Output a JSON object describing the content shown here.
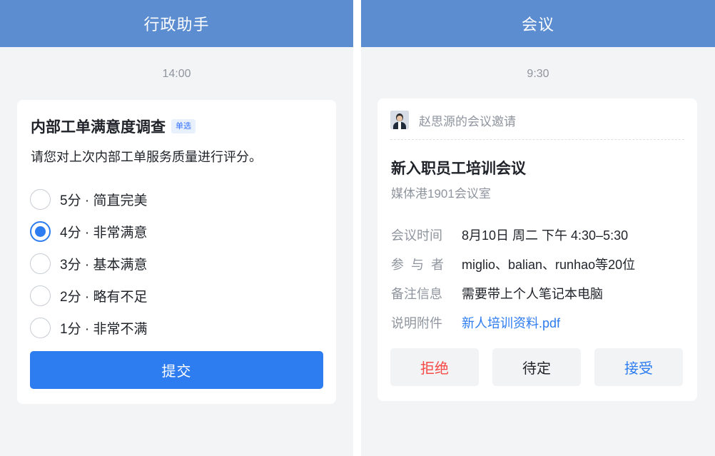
{
  "left_panel": {
    "title": "行政助手",
    "timestamp": "14:00",
    "survey": {
      "title": "内部工单满意度调查",
      "badge": "单选",
      "description": "请您对上次内部工单服务质量进行评分。",
      "options": [
        {
          "label": "5分 · 简直完美",
          "selected": false
        },
        {
          "label": "4分 · 非常满意",
          "selected": true
        },
        {
          "label": "3分 · 基本满意",
          "selected": false
        },
        {
          "label": "2分 · 略有不足",
          "selected": false
        },
        {
          "label": "1分 · 非常不满",
          "selected": false
        }
      ],
      "submit_label": "提交"
    }
  },
  "right_panel": {
    "title": "会议",
    "timestamp": "9:30",
    "invite": {
      "from": "赵思源的会议邀请",
      "title": "新入职员工培训会议",
      "location": "媒体港1901会议室",
      "rows": [
        {
          "key": "会议时间",
          "value": "8月10日 周二 下午 4:30–5:30"
        },
        {
          "key": "参与者",
          "value": "miglio、balian、runhao等20位"
        },
        {
          "key": "备注信息",
          "value": "需要带上个人笔记本电脑"
        },
        {
          "key": "说明附件",
          "value": "新人培训资料.pdf"
        }
      ],
      "actions": {
        "reject": "拒绝",
        "pending": "待定",
        "accept": "接受"
      }
    }
  },
  "colors": {
    "titlebar": "#5b8dd0",
    "primary": "#2d7cf0",
    "danger": "#f54a45",
    "background": "#f3f4f6"
  }
}
